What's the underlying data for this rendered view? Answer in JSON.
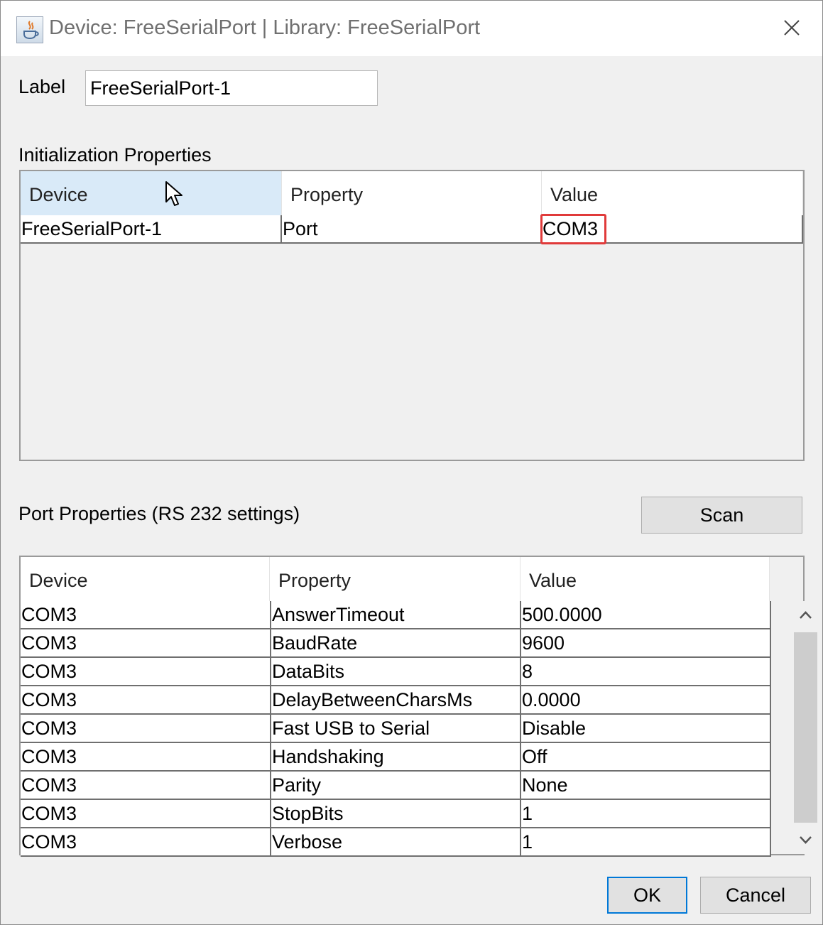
{
  "window": {
    "title": "Device: FreeSerialPort | Library: FreeSerialPort"
  },
  "label_field": {
    "label": "Label",
    "value": "FreeSerialPort-1"
  },
  "init_properties": {
    "title": "Initialization Properties",
    "columns": [
      "Device",
      "Property",
      "Value"
    ],
    "rows": [
      {
        "device": "FreeSerialPort-1",
        "property": "Port",
        "value": "COM3"
      }
    ]
  },
  "port_properties": {
    "title": "Port Properties (RS 232 settings)",
    "scan_label": "Scan",
    "columns": [
      "Device",
      "Property",
      "Value"
    ],
    "rows": [
      {
        "device": "COM3",
        "property": "AnswerTimeout",
        "value": "500.0000"
      },
      {
        "device": "COM3",
        "property": "BaudRate",
        "value": "9600"
      },
      {
        "device": "COM3",
        "property": "DataBits",
        "value": "8"
      },
      {
        "device": "COM3",
        "property": "DelayBetweenCharsMs",
        "value": "0.0000"
      },
      {
        "device": "COM3",
        "property": "Fast USB to Serial",
        "value": "Disable"
      },
      {
        "device": "COM3",
        "property": "Handshaking",
        "value": "Off"
      },
      {
        "device": "COM3",
        "property": "Parity",
        "value": "None"
      },
      {
        "device": "COM3",
        "property": "StopBits",
        "value": "1"
      },
      {
        "device": "COM3",
        "property": "Verbose",
        "value": "1"
      }
    ]
  },
  "buttons": {
    "ok": "OK",
    "cancel": "Cancel"
  },
  "icons": {
    "app": "java-icon",
    "close": "close-icon",
    "scroll_up": "chevron-up-icon",
    "scroll_down": "chevron-down-icon",
    "cursor": "mouse-pointer-icon"
  },
  "colors": {
    "selected_header": "#d9eaf8",
    "highlight_border": "#e03a3a",
    "default_button_border": "#0078d7"
  }
}
